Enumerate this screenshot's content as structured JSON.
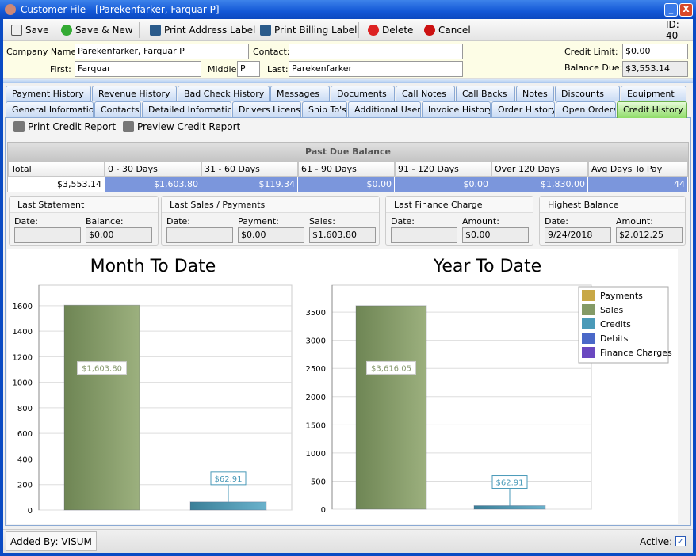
{
  "window": {
    "title": "Customer File - [Parekenfarker, Farquar P]",
    "minimize": "_",
    "close": "X"
  },
  "toolbar": {
    "save": "Save",
    "save_new": "Save & New",
    "print_address": "Print Address Label",
    "print_billing": "Print Billing Label",
    "delete": "Delete",
    "cancel": "Cancel",
    "id": "ID: 40"
  },
  "header": {
    "company_label": "Company Name:",
    "company": "Parekenfarker, Farquar P",
    "contact_label": "Contact:",
    "contact": "",
    "first_label": "First:",
    "first": "Farquar",
    "middle_label": "Middle:",
    "middle": "P",
    "last_label": "Last:",
    "last": "Parekenfarker",
    "credit_limit_label": "Credit Limit:",
    "credit_limit": "$0.00",
    "balance_due_label": "Balance Due:",
    "balance_due": "$3,553.14"
  },
  "tabs_row1": [
    "Payment History",
    "Revenue History",
    "Bad Check History",
    "Messages",
    "Documents",
    "Call Notes",
    "Call Backs",
    "Notes",
    "Discounts",
    "Equipment"
  ],
  "tabs_row2": [
    "General Information",
    "Contacts",
    "Detailed Information",
    "Drivers License",
    "Ship To's",
    "Additional Users",
    "Invoice History",
    "Order History",
    "Open Orders",
    "Credit History"
  ],
  "active_tab": "Credit History",
  "report": {
    "print": "Print Credit Report",
    "preview": "Preview Credit Report"
  },
  "past_due": {
    "title": "Past Due Balance",
    "columns": [
      "Total",
      "0 - 30 Days",
      "31 - 60 Days",
      "61 - 90 Days",
      "91 - 120 Days",
      "Over 120 Days",
      "Avg Days To Pay"
    ],
    "values": [
      "$3,553.14",
      "$1,603.80",
      "$119.34",
      "$0.00",
      "$0.00",
      "$1,830.00",
      "44"
    ]
  },
  "groups": [
    {
      "title": "Last Statement",
      "fields": [
        {
          "label": "Date:",
          "value": ""
        },
        {
          "label": "Balance:",
          "value": "$0.00"
        }
      ]
    },
    {
      "title": "Last Sales / Payments",
      "fields": [
        {
          "label": "Date:",
          "value": ""
        },
        {
          "label": "Payment:",
          "value": "$0.00"
        },
        {
          "label": "Sales:",
          "value": "$1,603.80"
        }
      ]
    },
    {
      "title": "Last Finance Charge",
      "fields": [
        {
          "label": "Date:",
          "value": ""
        },
        {
          "label": "Amount:",
          "value": "$0.00"
        }
      ]
    },
    {
      "title": "Highest Balance",
      "fields": [
        {
          "label": "Date:",
          "value": "9/24/2018"
        },
        {
          "label": "Amount:",
          "value": "$2,012.25"
        }
      ]
    }
  ],
  "legend": [
    {
      "name": "Payments",
      "color": "#c8a846"
    },
    {
      "name": "Sales",
      "color": "#849a66"
    },
    {
      "name": "Credits",
      "color": "#4a9ab8"
    },
    {
      "name": "Debits",
      "color": "#4a68c8"
    },
    {
      "name": "Finance Charges",
      "color": "#6a48c0"
    }
  ],
  "chart_data": [
    {
      "type": "bar",
      "title": "Month To Date",
      "ylim": [
        0,
        1760
      ],
      "yticks": [
        0,
        200,
        400,
        600,
        800,
        1000,
        1200,
        1400,
        1600
      ],
      "grid": true,
      "bars": [
        {
          "series": "Sales",
          "value": 1603.8,
          "label": "$1,603.80"
        },
        {
          "series": "Credits",
          "value": 62.91,
          "label": "$62.91"
        }
      ]
    },
    {
      "type": "bar",
      "title": "Year To Date",
      "ylim": [
        0,
        3980
      ],
      "yticks": [
        0,
        500,
        1000,
        1500,
        2000,
        2500,
        3000,
        3500
      ],
      "grid": true,
      "legend": "right",
      "bars": [
        {
          "series": "Sales",
          "value": 3616.05,
          "label": "$3,616.05"
        },
        {
          "series": "Credits",
          "value": 62.91,
          "label": "$62.91"
        }
      ]
    }
  ],
  "status": {
    "added_by": "Added By: VISUM",
    "active_label": "Active:",
    "active": true
  }
}
